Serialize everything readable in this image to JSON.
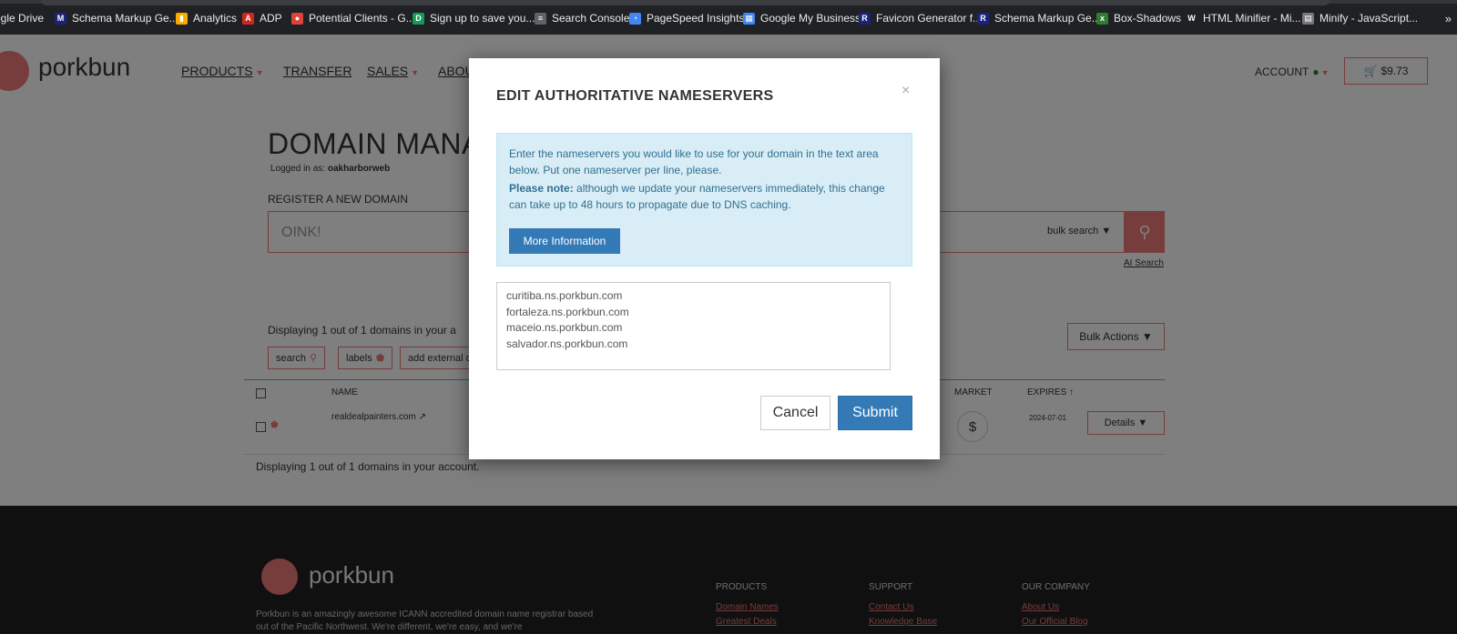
{
  "bookmarks": [
    {
      "label": "ogle Drive",
      "icon": "google-drive-icon",
      "color": "#34a853",
      "glyph": "▲"
    },
    {
      "label": "Schema Markup Ge...",
      "icon": "schema-icon",
      "color": "#1a237e",
      "glyph": "M"
    },
    {
      "label": "Analytics",
      "icon": "analytics-icon",
      "color": "#f9ab00",
      "glyph": "▮"
    },
    {
      "label": "ADP",
      "icon": "adp-icon",
      "color": "#d0271d",
      "glyph": "A"
    },
    {
      "label": "Potential Clients - G...",
      "icon": "map-pin-icon",
      "color": "#db4437",
      "glyph": "●"
    },
    {
      "label": "Sign up to save you...",
      "icon": "signup-icon",
      "color": "#0f9d58",
      "glyph": "D"
    },
    {
      "label": "Search Console",
      "icon": "search-console-icon",
      "color": "#5f6368",
      "glyph": "≡"
    },
    {
      "label": "PageSpeed Insights",
      "icon": "pagespeed-icon",
      "color": "#4285f4",
      "glyph": "◔"
    },
    {
      "label": "Google My Business",
      "icon": "business-icon",
      "color": "#4285f4",
      "glyph": "▦"
    },
    {
      "label": "Favicon Generator f...",
      "icon": "favicon-icon",
      "color": "#1a237e",
      "glyph": "R"
    },
    {
      "label": "Schema Markup Ge...",
      "icon": "schema-r-icon",
      "color": "#1a237e",
      "glyph": "R"
    },
    {
      "label": "Box-Shadows",
      "icon": "box-shadows-icon",
      "color": "#2e7d32",
      "glyph": "x"
    },
    {
      "label": "HTML Minifier - Mi...",
      "icon": "wikipedia-icon",
      "color": "#202124",
      "glyph": "W"
    },
    {
      "label": "Minify - JavaScript...",
      "icon": "minify-icon",
      "color": "#777777",
      "glyph": "▤"
    }
  ],
  "bookmarks_more": "»",
  "header": {
    "logo": "porkbun",
    "nav": [
      "PRODUCTS",
      "TRANSFER",
      "SALES",
      "ABOU"
    ],
    "account": "ACCOUNT",
    "cart": "$9.73"
  },
  "main": {
    "title": "DOMAIN MANA",
    "logged_in_prefix": "Logged in as:",
    "username": "oakharborweb",
    "register_label": "REGISTER A NEW DOMAIN",
    "search_placeholder": "OINK!",
    "bulk_search": "bulk search",
    "ai_search": "AI Search",
    "displaying_top": "Displaying 1 out of 1 domains in your a",
    "chips": [
      "search",
      "labels",
      "add external d"
    ],
    "bulk_actions": "Bulk Actions ▼",
    "columns": {
      "name": "NAME",
      "market": "MARKET",
      "expires": "EXPIRES"
    },
    "row": {
      "domain": "realdealpainters.com",
      "market_symbol": "$",
      "expires": "2024-07-01",
      "details": "Details ▼"
    },
    "displaying_bottom": "Displaying 1 out of 1 domains in your account."
  },
  "footer": {
    "logo": "porkbun",
    "description": "Porkbun is an amazingly awesome ICANN accredited domain name registrar based out of the Pacific Northwest. We're different, we're easy, and we're",
    "columns": [
      {
        "title": "PRODUCTS",
        "links": [
          "Domain Names",
          "Greatest Deals"
        ]
      },
      {
        "title": "SUPPORT",
        "links": [
          "Contact Us",
          "Knowledge Base"
        ]
      },
      {
        "title": "OUR COMPANY",
        "links": [
          "About Us",
          "Our Official Blog"
        ]
      }
    ]
  },
  "modal": {
    "title": "EDIT AUTHORITATIVE NAMESERVERS",
    "close": "×",
    "info_p1": "Enter the nameservers you would like to use for your domain in the text area below. Put one nameserver per line, please.",
    "info_note_label": "Please note:",
    "info_note_text": "although we update your nameservers immediately, this change can take up to 48 hours to propagate due to DNS caching.",
    "more_info": "More Information",
    "nameservers": [
      "curitiba.ns.porkbun.com",
      "fortaleza.ns.porkbun.com",
      "maceio.ns.porkbun.com",
      "salvador.ns.porkbun.com"
    ],
    "cancel": "Cancel",
    "submit": "Submit"
  },
  "colors": {
    "brand": "#ef7878",
    "primary": "#337ab7",
    "info_bg": "#d9edf7",
    "info_text": "#31708f"
  }
}
